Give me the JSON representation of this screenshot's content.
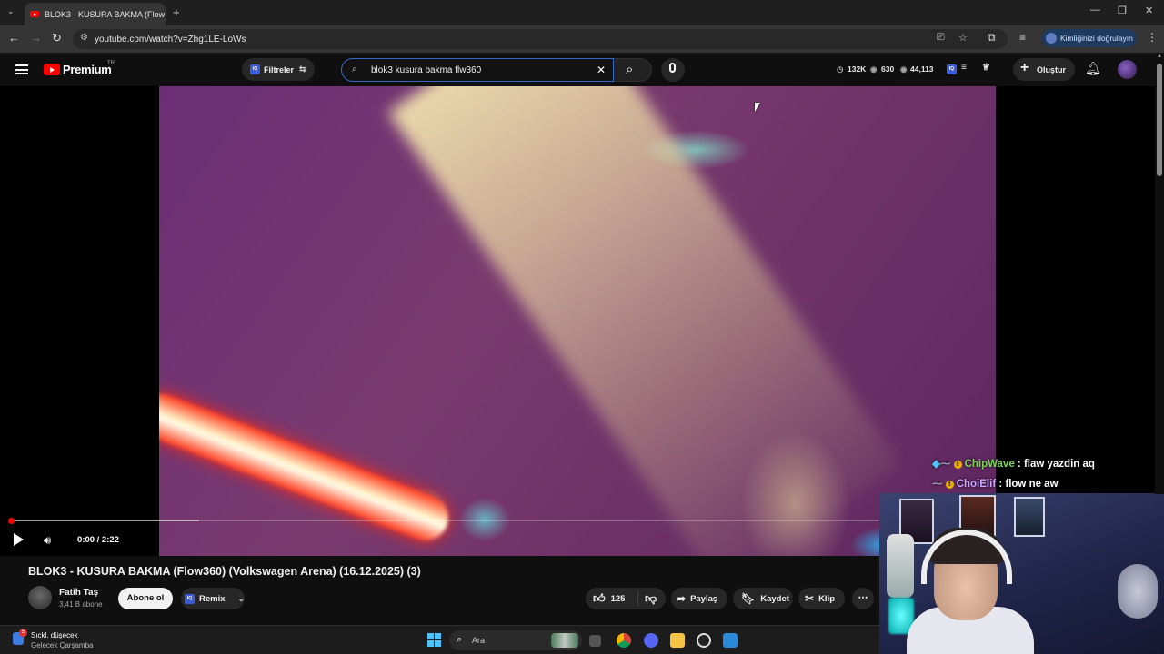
{
  "browser": {
    "tab_title": "BLOK3 - KUSURA BAKMA (Flow",
    "url": "youtube.com/watch?v=Zhg1LE-LoWs",
    "verify_identity": "Kimliğinizi doğrulayın"
  },
  "header": {
    "brand": "Premium",
    "region": "TR",
    "filters_label": "Filtreler",
    "ext_badge": "IQ",
    "search_value": "blok3 kusura bakma flw360",
    "stats": {
      "clock": "132K",
      "views": "630",
      "eye": "44,113"
    },
    "create_label": "Oluştur"
  },
  "player": {
    "current_time": "0:00 / 2:22",
    "progress_fraction": 0.0,
    "buffer_fraction": 0.22
  },
  "chat": [
    {
      "user": "ChipWave",
      "message": " : flaw yazdin aq"
    },
    {
      "user": "ChoiElif",
      "message": " : flow ne aw"
    }
  ],
  "video": {
    "title": "BLOK3 - KUSURA BAKMA (Flow360) (Volkswagen Arena) (16.12.2025) (3)",
    "channel": "Fatih Taş",
    "subscribers": "3,41 B abone",
    "subscribe_label": "Abone ol",
    "remix_label": "Remix",
    "likes": "125",
    "share_label": "Paylaş",
    "save_label": "Kaydet",
    "clip_label": "Klip"
  },
  "taskbar": {
    "weather_line1": "Sıckl. düşecek",
    "weather_line2": "Gelecek Çarşamba",
    "weather_badge": "5",
    "search_placeholder": "Ara"
  },
  "colors": {
    "accent": "#ff0000",
    "chat_user1": "#7dd35a",
    "chat_user2": "#c9a5ff",
    "search_border": "#3569c6"
  }
}
